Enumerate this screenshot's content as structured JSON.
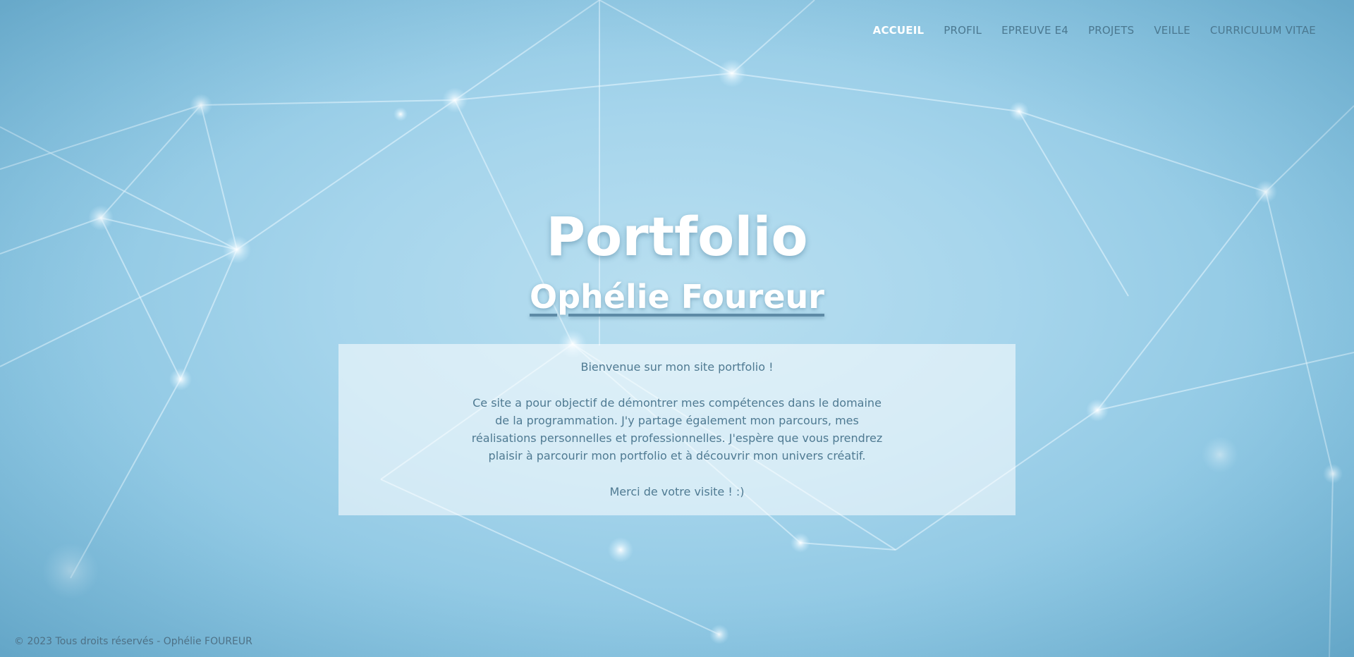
{
  "nav": {
    "items": [
      {
        "label": "ACCUEIL",
        "active": true
      },
      {
        "label": "PROFIL",
        "active": false
      },
      {
        "label": "EPREUVE E4",
        "active": false
      },
      {
        "label": "PROJETS",
        "active": false
      },
      {
        "label": "VEILLE",
        "active": false
      },
      {
        "label": "CURRICULUM VITAE",
        "active": false
      }
    ]
  },
  "hero": {
    "title": "Portfolio",
    "subtitle": "Ophélie Foureur"
  },
  "welcome": {
    "greeting": "Bienvenue sur mon site portfolio !",
    "body": "Ce site a pour objectif de démontrer mes compétences dans le domaine de la programmation. J'y partage également mon parcours, mes réalisations personnelles et professionnelles. J'espère que vous prendrez plaisir à parcourir mon portfolio et à découvrir mon univers créatif.",
    "thanks": "Merci de votre visite ! :)"
  },
  "footer": {
    "text": "© 2023 Tous droits réservés - Ophélie FOUREUR"
  },
  "colors": {
    "background": "#a6d5ec",
    "nav_text": "#4b7890",
    "nav_active": "#ffffff",
    "title_text": "#ffffff",
    "box_text": "#4f7a92"
  }
}
